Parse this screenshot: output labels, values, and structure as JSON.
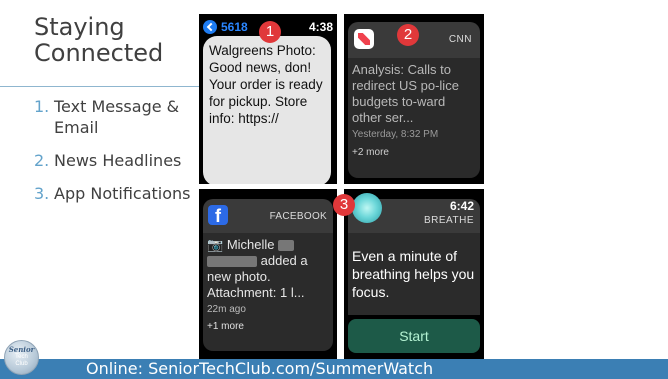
{
  "slide": {
    "title_line1": "Staying",
    "title_line2": "Connected",
    "bullets": [
      {
        "num": "1.",
        "text": "Text Message & Email"
      },
      {
        "num": "2.",
        "text": "News Headlines"
      },
      {
        "num": "3.",
        "text": "App Notifications"
      }
    ],
    "footer": "Online: SeniorTechClub.com/SummerWatch",
    "logo": {
      "line1": "Senior",
      "line2": "Tech",
      "line3": "Club"
    }
  },
  "badges": [
    "1",
    "2",
    "3"
  ],
  "tile1": {
    "sender": "5618",
    "time": "4:38",
    "message": "Walgreens Photo: Good news, don! Your order is ready for pickup. Store info: https://"
  },
  "tile2": {
    "app": "CNN",
    "headline": "Analysis: Calls to redirect US po-lice budgets to-ward other ser...",
    "date": "Yesterday, 8:32 PM",
    "more": "+2 more"
  },
  "tile3": {
    "app": "FACEBOOK",
    "name": "Michelle",
    "action": "added a",
    "rest": "new photo. Attachment: 1 l...",
    "ago": "22m ago",
    "more": "+1 more"
  },
  "tile4": {
    "time": "6:42",
    "app": "BREATHE",
    "message": "Even a minute of breathing helps you focus.",
    "button": "Start"
  },
  "colors": {
    "accent": "#3b7fb4",
    "bullet_number": "#63a3cb",
    "badge": "#e0383a",
    "start_button": "#1d5a48"
  },
  "icons": [
    "chevron-left-icon",
    "news-app-icon",
    "facebook-icon",
    "camera-emoji-icon",
    "breathe-icon"
  ]
}
